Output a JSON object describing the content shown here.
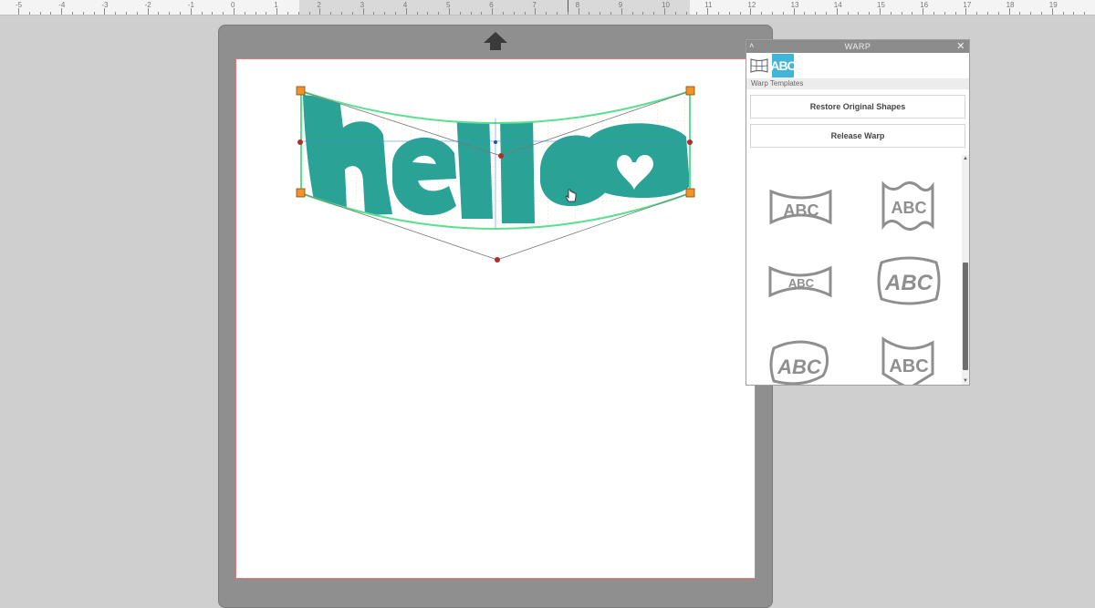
{
  "ruler": {
    "numbers": [
      "-5",
      "-4",
      "-3",
      "-2",
      "-1",
      "0",
      "1",
      "2",
      "3",
      "4",
      "5",
      "6",
      "7",
      "8",
      "9",
      "10",
      "11",
      "12",
      "13",
      "14",
      "15",
      "16",
      "17",
      "18",
      "19"
    ]
  },
  "canvas": {
    "artwork_text": "hello",
    "artwork_color": "#2aa396",
    "selection_color": "#5be08f",
    "handle_color": "#f0932b"
  },
  "warp_panel": {
    "title": "WARP",
    "collapse_icon": "chevron-up-icon",
    "close_icon": "close-icon",
    "tabs": [
      {
        "name": "mesh-warp-tab",
        "icon": "mesh-grid-icon"
      },
      {
        "name": "text-warp-tab",
        "label": "ABC",
        "active": true
      }
    ],
    "section_label": "Warp Templates",
    "restore_button": "Restore Original Shapes",
    "release_button": "Release Warp",
    "templates": [
      {
        "id": "arch-in",
        "label": "ABC"
      },
      {
        "id": "wave-flag",
        "label": "ABC"
      },
      {
        "id": "bow-tie",
        "label": "ABC"
      },
      {
        "id": "bulge",
        "label": "ABC"
      },
      {
        "id": "twist",
        "label": "ABC"
      },
      {
        "id": "shield",
        "label": "ABC"
      }
    ]
  }
}
